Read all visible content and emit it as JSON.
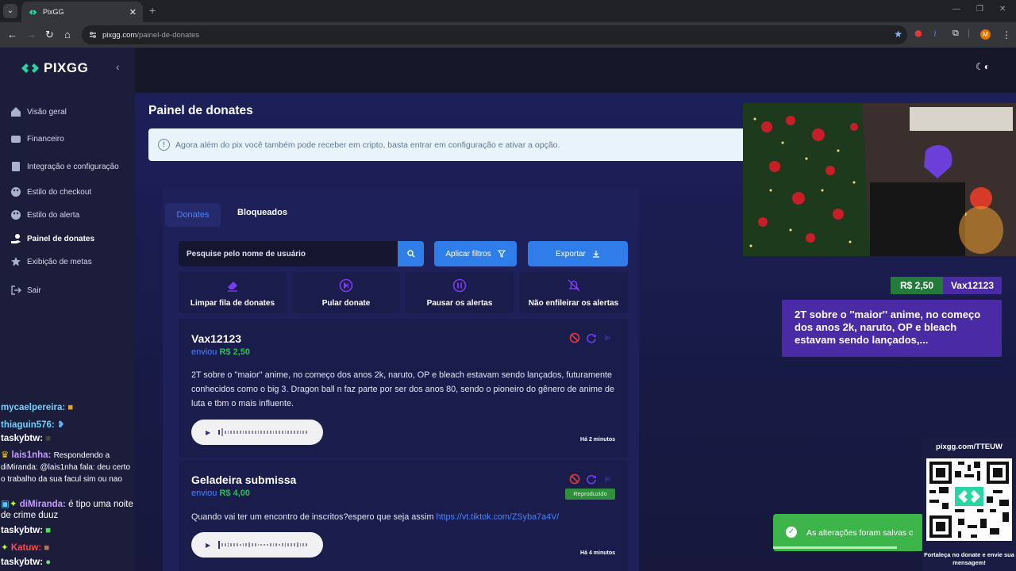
{
  "browser": {
    "tab_title": "PixGG",
    "url_domain": "pixgg.com",
    "url_path": "/painel-de-donates",
    "profile_initial": "M"
  },
  "sidebar": {
    "brand": "PIXGG",
    "items": [
      {
        "label": "Visão geral",
        "icon": "home-icon"
      },
      {
        "label": "Financeiro",
        "icon": "wallet-icon"
      },
      {
        "label": "Integração e configuração",
        "icon": "settings-icon"
      },
      {
        "label": "Estilo do checkout",
        "icon": "palette-icon"
      },
      {
        "label": "Estilo do alerta",
        "icon": "palette-icon"
      },
      {
        "label": "Painel de donates",
        "icon": "hand-coin-icon",
        "active": true
      },
      {
        "label": "Exibição de metas",
        "icon": "star-icon"
      },
      {
        "label": "Sair",
        "icon": "logout-icon"
      }
    ]
  },
  "page": {
    "title": "Painel de donates",
    "info": "Agora além do pix você também pode receber em cripto, basta entrar em configuração e ativar a opção."
  },
  "tabs": {
    "donates": "Donates",
    "bloqueados": "Bloqueados"
  },
  "controls": {
    "search_placeholder": "Pesquise pelo nome de usuário",
    "filters": "Aplicar filtros",
    "export": "Exportar"
  },
  "actions": [
    {
      "label": "Limpar fila de donates",
      "icon": "eraser-icon"
    },
    {
      "label": "Pular donate",
      "icon": "skip-icon"
    },
    {
      "label": "Pausar os alertas",
      "icon": "pause-icon"
    },
    {
      "label": "Não enfileirar os alertas",
      "icon": "bell-off-icon"
    }
  ],
  "donations": [
    {
      "name": "Vax12123",
      "verb": "enviou",
      "amount": "R$ 2,50",
      "message": "2T sobre o ''maior'' anime, no começo dos anos 2k, naruto, OP e bleach estavam sendo lançados, futuramente conhecidos como o big 3. Dragon ball n faz parte por ser dos anos 80, sendo o pioneiro do gênero de anime de luta e tbm o mais influente.",
      "link": "",
      "time": "Há 2 minutos"
    },
    {
      "name": "Geladeira submissa",
      "verb": "enviou",
      "amount": "R$ 4,00",
      "message": "Quando vai ter um encontro de inscritos?espero que seja assim ",
      "link": "https://vt.tiktok.com/ZSyba7a4V/",
      "status": "Reproduzido",
      "time": "Há 4 minutos"
    }
  ],
  "alert_overlay": {
    "amount": "R$ 2,50",
    "user": "Vax12123",
    "message": "2T sobre o ''maior'' anime, no começo dos anos 2k, naruto, OP e bleach estavam sendo lançados,..."
  },
  "chat": [
    {
      "user": "mycaelpereira:",
      "color": "#6fd3ff",
      "text": ""
    },
    {
      "user": "thiaguin576:",
      "color": "#6fd3ff",
      "text": ""
    },
    {
      "user": "taskybtw:",
      "color": "#ffffff",
      "text": ""
    },
    {
      "user": "lais1nha:",
      "color": "#c69cff",
      "text": "Respondendo a diMiranda: @lais1nha fala: deu certo o trabalho da sua facul sim ou nao"
    },
    {
      "user": "diMiranda:",
      "color": "#c69cff",
      "text": "é tipo uma noite de crime duuz"
    },
    {
      "user": "taskybtw:",
      "color": "#ffffff",
      "text": ""
    },
    {
      "user": "Katuw:",
      "color": "#ff4b4b",
      "text": ""
    },
    {
      "user": "taskybtw:",
      "color": "#ffffff",
      "text": ""
    }
  ],
  "toast": {
    "message": "As alterações foram salvas c"
  },
  "qr": {
    "url": "pixgg.com/TTEUW",
    "caption": "Fortaleça no donate e envie sua mensagem!"
  },
  "colors": {
    "accent": "#2e7de9",
    "amount_green": "#24c24a",
    "alert_purple": "#4b2aa6"
  }
}
